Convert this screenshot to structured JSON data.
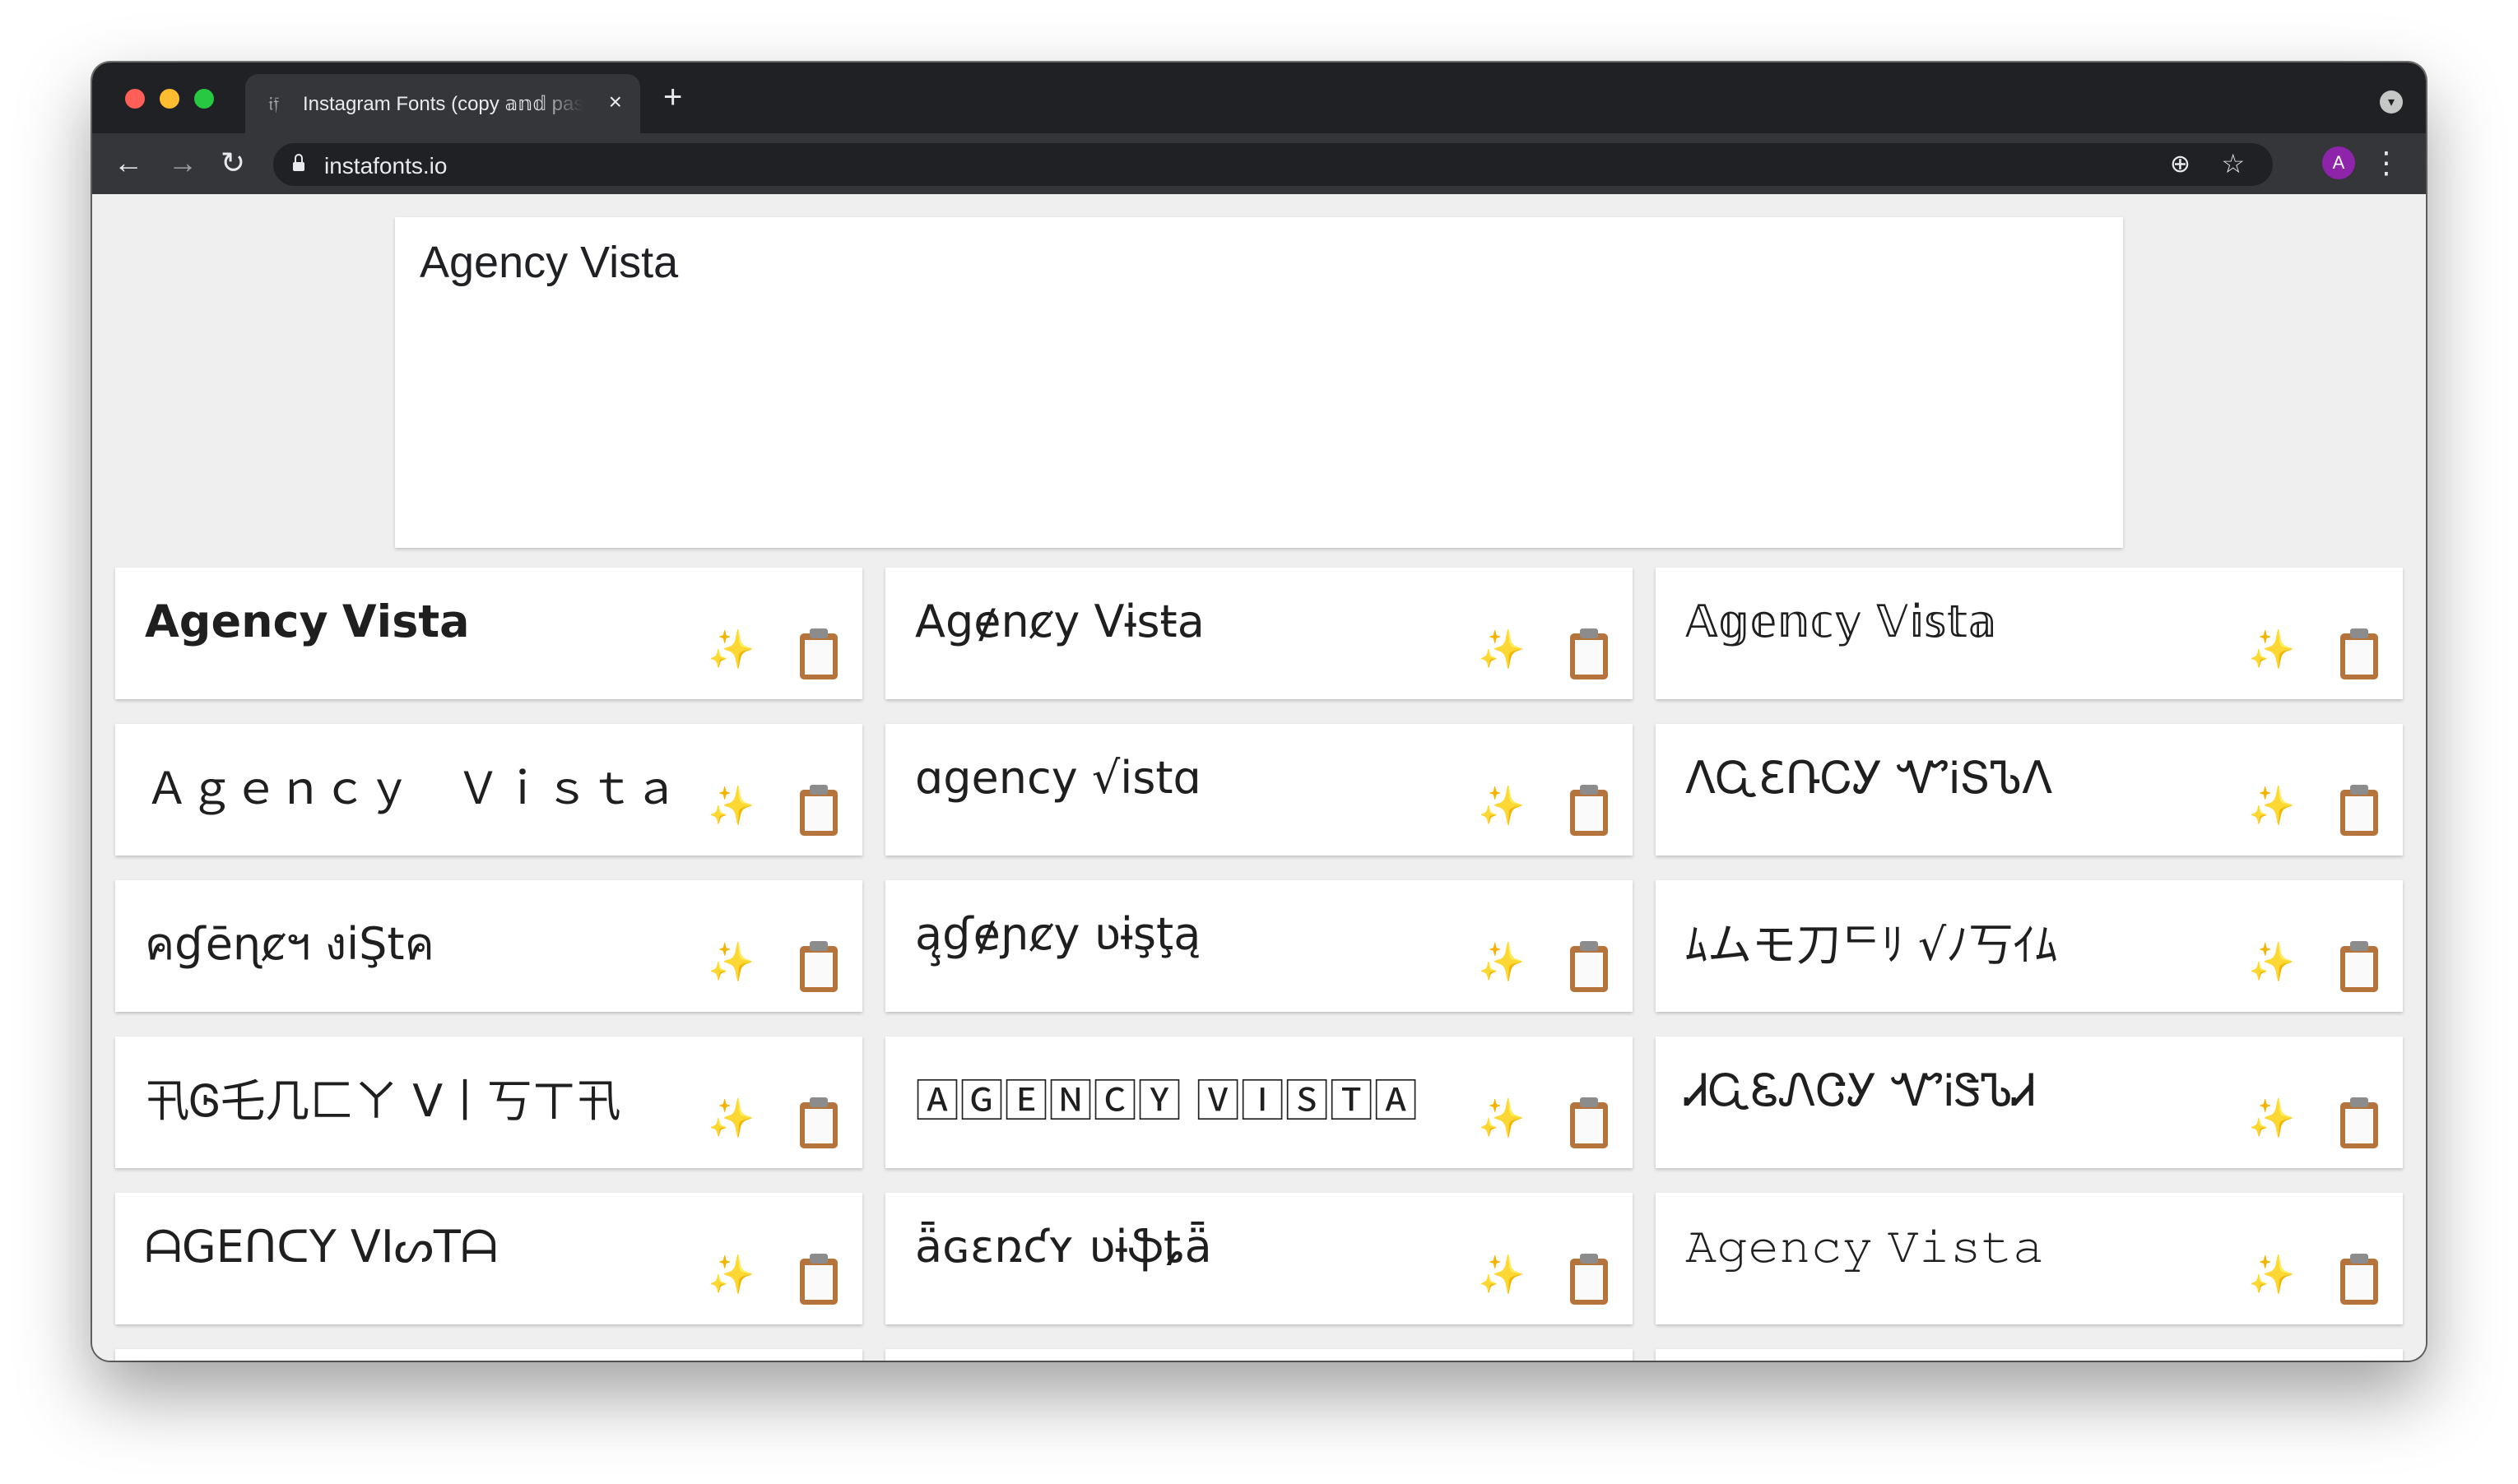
{
  "browser": {
    "tab_title": "Instagram Fonts (copy 𝕒𝕟𝕕 paste)",
    "tab_favicon": "𝔦𝔣",
    "tab_close": "×",
    "new_tab": "+",
    "url": "instafonts.io",
    "avatar_letter": "A",
    "icons": {
      "back": "←",
      "forward": "→",
      "reload": "↻",
      "zoom": "⊕",
      "star": "☆",
      "kebab": "⋮",
      "tab_menu": "▾"
    }
  },
  "input": {
    "text": "Agency Vista"
  },
  "cards": [
    {
      "text": "𝗔𝗴𝗲𝗻𝗰𝘆 𝗩𝗶𝘀𝘁𝗮"
    },
    {
      "text": "Agɇnȼy Vɨsŧa"
    },
    {
      "text": "𝔸𝕘𝕖𝕟𝕔𝕪 𝕍𝕚𝕤𝕥𝕒"
    },
    {
      "text": "Ａｇｅｎｃｙ　Ｖｉｓｔａ"
    },
    {
      "text": "ɑgency √istɑ"
    },
    {
      "text": "ΛᏩƐՌᏟᎩ ᏉᎥՏᏖΛ"
    },
    {
      "text": "คɠēɳȼฯ งiŞtค"
    },
    {
      "text": "ą̧ɠɇɲȼy ʋɨşţą"
    },
    {
      "text": "ﾑムモ刀ᄃﾘ √ﾉ丂ｲﾑ"
    },
    {
      "text": "卂Ꮆ乇几匚ㄚ ᐯ丨丂ㄒ卂"
    },
    {
      "text": "🄰🄶🄴🄽🄲🅈 🅅🄸🅂🅃🄰"
    },
    {
      "text": "ᏗᏩᏋᏁᏣᎩ ᏉᎥᏕᏖᏗ"
    },
    {
      "text": "ᗩGEᑎᑕY ᐯIᔕTᗩ"
    },
    {
      "text": "ǟɢɛռƈʏ ʋɨֆȶǟ"
    },
    {
      "text": "𝙰𝚐𝚎𝚗𝚌𝚢 𝚅𝚒𝚜𝚝𝚊"
    }
  ],
  "card_icons": {
    "sparkle": "✨",
    "clipboard": "clipboard-icon"
  }
}
